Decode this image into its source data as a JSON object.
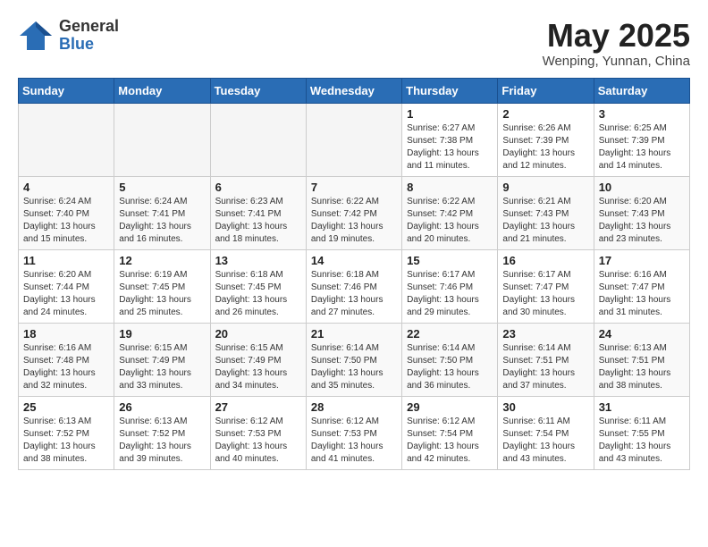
{
  "header": {
    "logo_general": "General",
    "logo_blue": "Blue",
    "month_title": "May 2025",
    "location": "Wenping, Yunnan, China"
  },
  "weekdays": [
    "Sunday",
    "Monday",
    "Tuesday",
    "Wednesday",
    "Thursday",
    "Friday",
    "Saturday"
  ],
  "weeks": [
    [
      {
        "day": "",
        "info": ""
      },
      {
        "day": "",
        "info": ""
      },
      {
        "day": "",
        "info": ""
      },
      {
        "day": "",
        "info": ""
      },
      {
        "day": "1",
        "info": "Sunrise: 6:27 AM\nSunset: 7:38 PM\nDaylight: 13 hours and 11 minutes."
      },
      {
        "day": "2",
        "info": "Sunrise: 6:26 AM\nSunset: 7:39 PM\nDaylight: 13 hours and 12 minutes."
      },
      {
        "day": "3",
        "info": "Sunrise: 6:25 AM\nSunset: 7:39 PM\nDaylight: 13 hours and 14 minutes."
      }
    ],
    [
      {
        "day": "4",
        "info": "Sunrise: 6:24 AM\nSunset: 7:40 PM\nDaylight: 13 hours and 15 minutes."
      },
      {
        "day": "5",
        "info": "Sunrise: 6:24 AM\nSunset: 7:41 PM\nDaylight: 13 hours and 16 minutes."
      },
      {
        "day": "6",
        "info": "Sunrise: 6:23 AM\nSunset: 7:41 PM\nDaylight: 13 hours and 18 minutes."
      },
      {
        "day": "7",
        "info": "Sunrise: 6:22 AM\nSunset: 7:42 PM\nDaylight: 13 hours and 19 minutes."
      },
      {
        "day": "8",
        "info": "Sunrise: 6:22 AM\nSunset: 7:42 PM\nDaylight: 13 hours and 20 minutes."
      },
      {
        "day": "9",
        "info": "Sunrise: 6:21 AM\nSunset: 7:43 PM\nDaylight: 13 hours and 21 minutes."
      },
      {
        "day": "10",
        "info": "Sunrise: 6:20 AM\nSunset: 7:43 PM\nDaylight: 13 hours and 23 minutes."
      }
    ],
    [
      {
        "day": "11",
        "info": "Sunrise: 6:20 AM\nSunset: 7:44 PM\nDaylight: 13 hours and 24 minutes."
      },
      {
        "day": "12",
        "info": "Sunrise: 6:19 AM\nSunset: 7:45 PM\nDaylight: 13 hours and 25 minutes."
      },
      {
        "day": "13",
        "info": "Sunrise: 6:18 AM\nSunset: 7:45 PM\nDaylight: 13 hours and 26 minutes."
      },
      {
        "day": "14",
        "info": "Sunrise: 6:18 AM\nSunset: 7:46 PM\nDaylight: 13 hours and 27 minutes."
      },
      {
        "day": "15",
        "info": "Sunrise: 6:17 AM\nSunset: 7:46 PM\nDaylight: 13 hours and 29 minutes."
      },
      {
        "day": "16",
        "info": "Sunrise: 6:17 AM\nSunset: 7:47 PM\nDaylight: 13 hours and 30 minutes."
      },
      {
        "day": "17",
        "info": "Sunrise: 6:16 AM\nSunset: 7:47 PM\nDaylight: 13 hours and 31 minutes."
      }
    ],
    [
      {
        "day": "18",
        "info": "Sunrise: 6:16 AM\nSunset: 7:48 PM\nDaylight: 13 hours and 32 minutes."
      },
      {
        "day": "19",
        "info": "Sunrise: 6:15 AM\nSunset: 7:49 PM\nDaylight: 13 hours and 33 minutes."
      },
      {
        "day": "20",
        "info": "Sunrise: 6:15 AM\nSunset: 7:49 PM\nDaylight: 13 hours and 34 minutes."
      },
      {
        "day": "21",
        "info": "Sunrise: 6:14 AM\nSunset: 7:50 PM\nDaylight: 13 hours and 35 minutes."
      },
      {
        "day": "22",
        "info": "Sunrise: 6:14 AM\nSunset: 7:50 PM\nDaylight: 13 hours and 36 minutes."
      },
      {
        "day": "23",
        "info": "Sunrise: 6:14 AM\nSunset: 7:51 PM\nDaylight: 13 hours and 37 minutes."
      },
      {
        "day": "24",
        "info": "Sunrise: 6:13 AM\nSunset: 7:51 PM\nDaylight: 13 hours and 38 minutes."
      }
    ],
    [
      {
        "day": "25",
        "info": "Sunrise: 6:13 AM\nSunset: 7:52 PM\nDaylight: 13 hours and 38 minutes."
      },
      {
        "day": "26",
        "info": "Sunrise: 6:13 AM\nSunset: 7:52 PM\nDaylight: 13 hours and 39 minutes."
      },
      {
        "day": "27",
        "info": "Sunrise: 6:12 AM\nSunset: 7:53 PM\nDaylight: 13 hours and 40 minutes."
      },
      {
        "day": "28",
        "info": "Sunrise: 6:12 AM\nSunset: 7:53 PM\nDaylight: 13 hours and 41 minutes."
      },
      {
        "day": "29",
        "info": "Sunrise: 6:12 AM\nSunset: 7:54 PM\nDaylight: 13 hours and 42 minutes."
      },
      {
        "day": "30",
        "info": "Sunrise: 6:11 AM\nSunset: 7:54 PM\nDaylight: 13 hours and 43 minutes."
      },
      {
        "day": "31",
        "info": "Sunrise: 6:11 AM\nSunset: 7:55 PM\nDaylight: 13 hours and 43 minutes."
      }
    ]
  ]
}
